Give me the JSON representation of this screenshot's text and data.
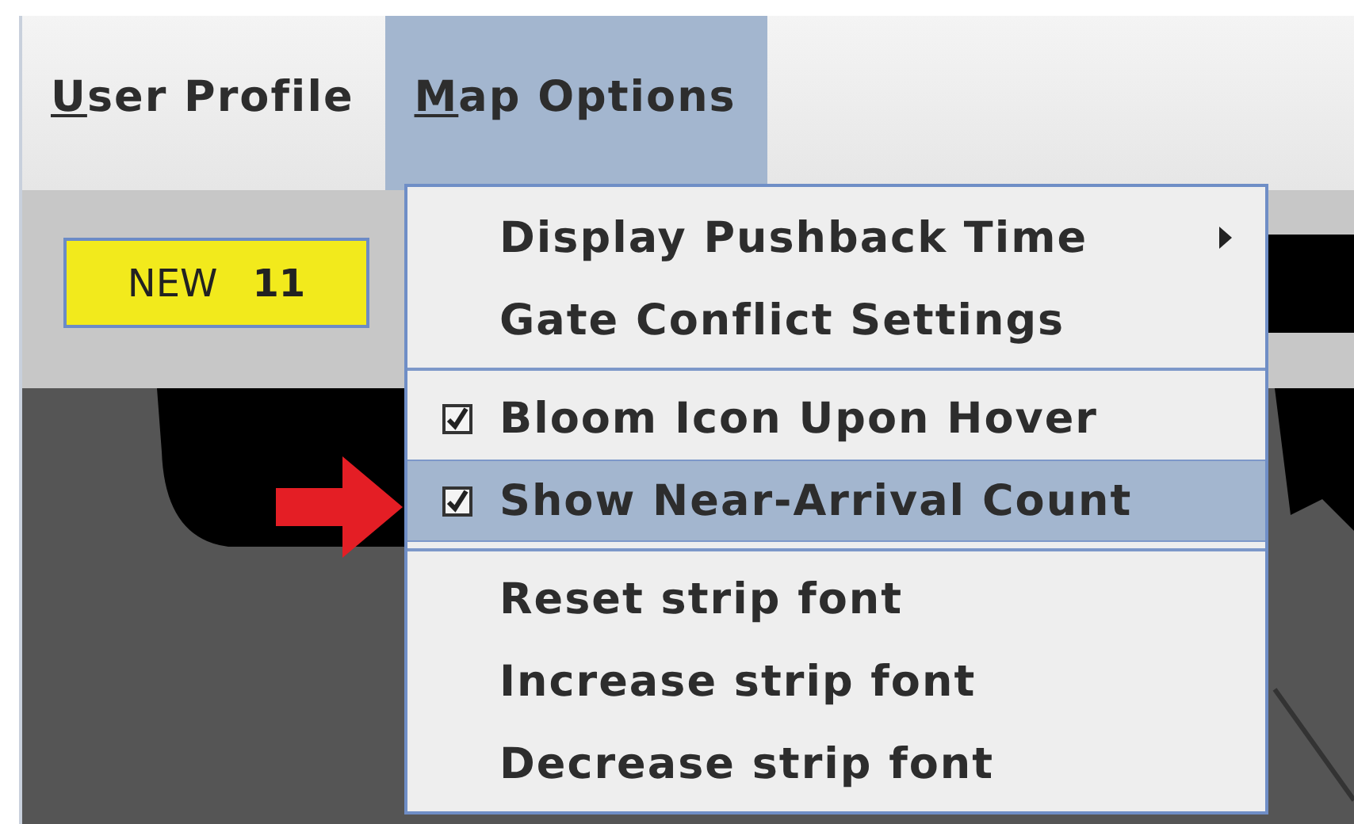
{
  "menubar": {
    "items": [
      {
        "label": "User Profile",
        "selected": false
      },
      {
        "label": "Map Options",
        "selected": true
      }
    ]
  },
  "toolbar": {
    "badge": {
      "label": "NEW",
      "count": "11"
    }
  },
  "menu": {
    "groups": [
      [
        {
          "label": "Display Pushback Time",
          "kind": "submenu",
          "selected": false
        },
        {
          "label": "Gate Conflict Settings",
          "kind": "plain",
          "selected": false
        }
      ],
      [
        {
          "label": "Bloom Icon Upon Hover",
          "kind": "check",
          "checked": true,
          "selected": false
        },
        {
          "label": "Show Near-Arrival Count",
          "kind": "check",
          "checked": true,
          "selected": true
        }
      ],
      [
        {
          "label": "Reset strip font",
          "kind": "plain",
          "selected": false
        },
        {
          "label": "Increase strip font",
          "kind": "plain",
          "selected": false
        },
        {
          "label": "Decrease strip font",
          "kind": "plain",
          "selected": false
        }
      ]
    ]
  }
}
